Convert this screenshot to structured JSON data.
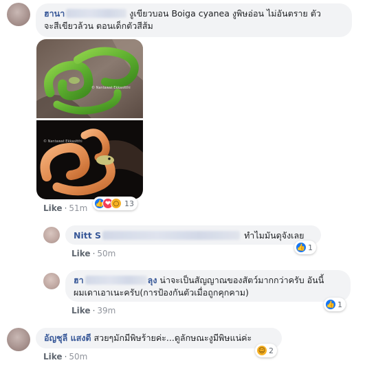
{
  "comments": [
    {
      "author": "ฮานา",
      "text_line1": "งูเขียวบอน Boiga cyanea งูพิษอ่อน ไม่อันตราย ตัว",
      "text_line2": "จะสีเขียวล้วน ตอนเด็กตัวสีส้ม",
      "like_label": "Like",
      "time": "51m",
      "reaction_count": "13",
      "reactions": [
        "like-icon",
        "love-icon",
        "wow-icon"
      ],
      "photo": {
        "watermark_top": "© Nantawat Ekkasitthi",
        "watermark_bottom": "© Nantawat Ekkasitthi"
      }
    },
    {
      "author": "Nitt S",
      "text": "ทำไมมันดุจังเลย",
      "like_label": "Like",
      "time": "50m",
      "reaction_count": "1",
      "reactions": [
        "like-icon"
      ]
    },
    {
      "author": "ฮา",
      "author_suffix": "ลุง",
      "text_line1": "น่าจะเป็นสัญญาณของสัตว์มากกว่าครับ อันนี้",
      "text_line2": "ผมเดาเอาเนะครับ(การป้องกันตัวเมื่อถูกคุกคาม)",
      "like_label": "Like",
      "time": "39m",
      "reaction_count": "1",
      "reactions": [
        "like-icon"
      ]
    },
    {
      "author": "อัญชุลี แสงดี",
      "text": "สวยๆมักมีพิษร้ายค่ะ...ดูลักษณะงูมีพิษแน่ค่ะ",
      "like_label": "Like",
      "time": "50m",
      "reaction_count": "2",
      "reactions": [
        "haha-icon"
      ]
    }
  ],
  "separator": "·",
  "colors": {
    "author": "#385898",
    "bubble": "#f2f3f5",
    "meta": "#606770",
    "like_reaction": "#1877f2",
    "love_reaction": "#f33e58",
    "wow_reaction": "#f7b125"
  }
}
